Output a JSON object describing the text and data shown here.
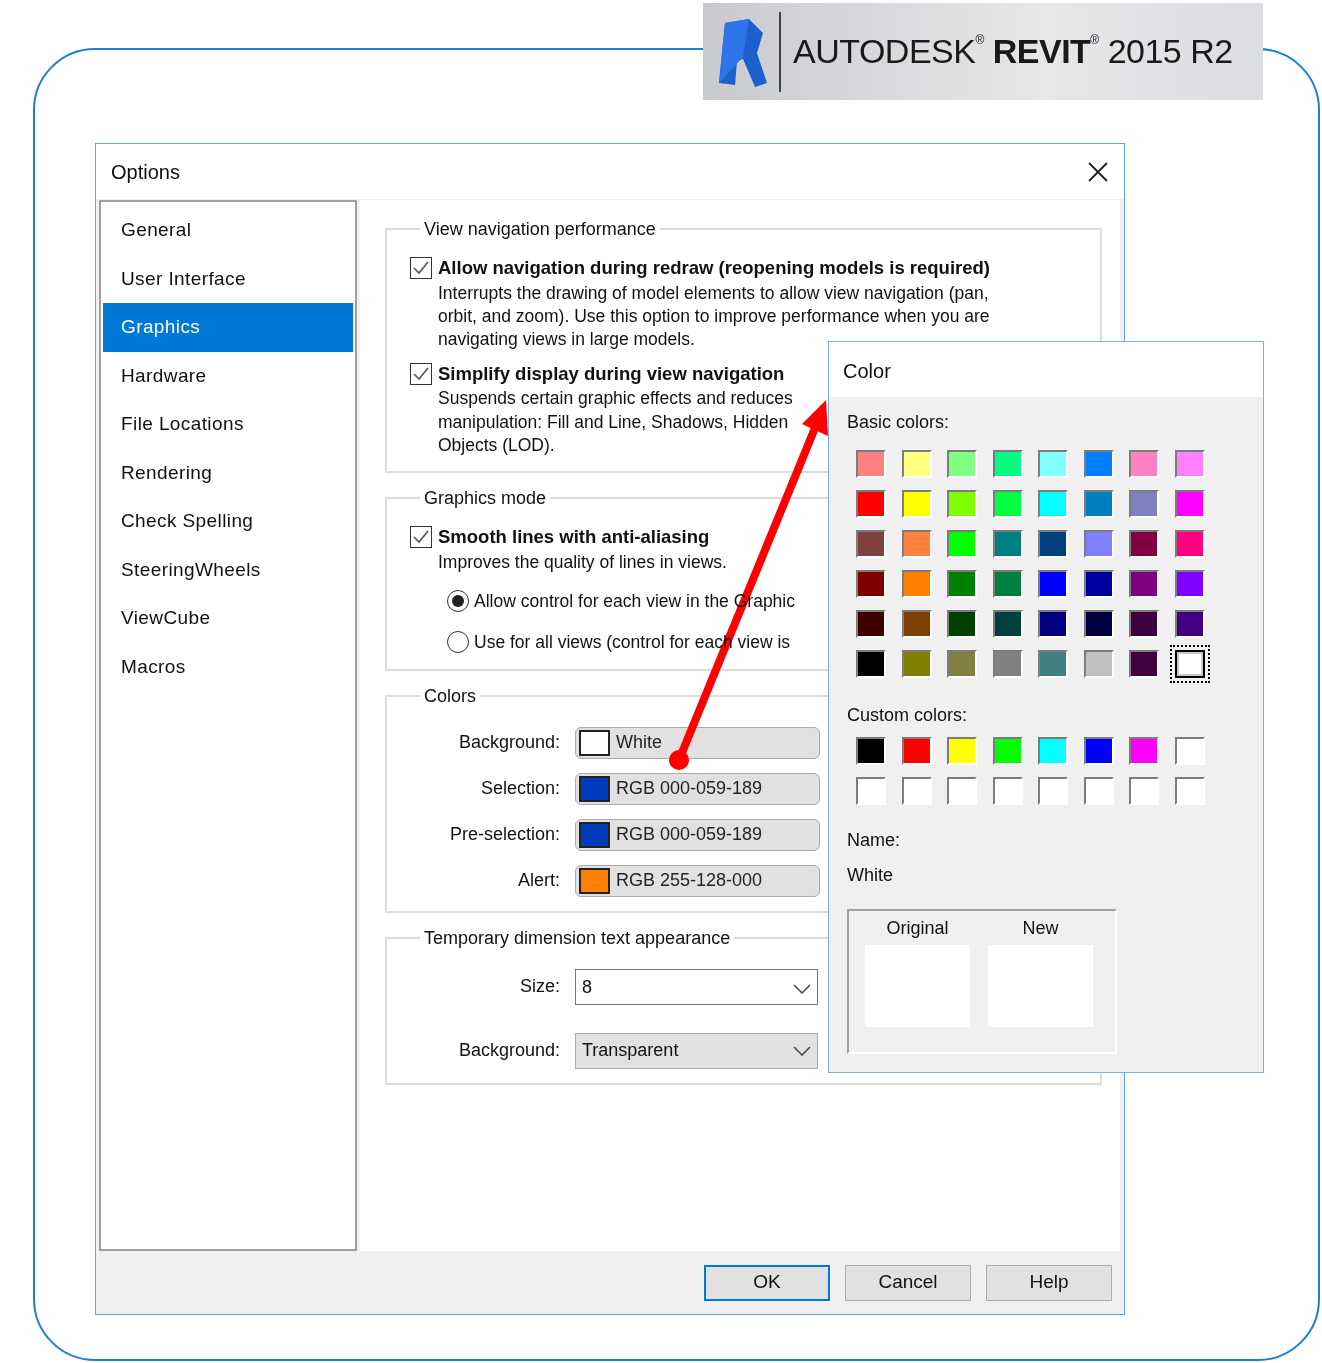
{
  "logo": {
    "text": "AUTODESK$^{®}$ **REVIT**$^{®}$ 2015 R2"
  },
  "options_dialog": {
    "title": "Options",
    "sidebar": {
      "items": [
        {
          "label": "General",
          "selected": false
        },
        {
          "label": "User Interface",
          "selected": false
        },
        {
          "label": "Graphics",
          "selected": true
        },
        {
          "label": "Hardware",
          "selected": false
        },
        {
          "label": "File Locations",
          "selected": false
        },
        {
          "label": "Rendering",
          "selected": false
        },
        {
          "label": "Check Spelling",
          "selected": false
        },
        {
          "label": "SteeringWheels",
          "selected": false
        },
        {
          "label": "ViewCube",
          "selected": false
        },
        {
          "label": "Macros",
          "selected": false
        }
      ]
    },
    "groups": [
      {
        "title": "View navigation performance",
        "items": [
          {
            "kind": "checkbox",
            "label": "Allow navigation during redraw (reopening models is required)",
            "checked": true,
            "description": "Interrupts the drawing of model elements to allow view navigation (pan,\norbit, and zoom). Use this option to improve performance when you are\nnavigating views in large models."
          },
          {
            "kind": "checkbox",
            "label": "Simplify display during view navigation",
            "checked": true,
            "description": "Suspends certain graphic effects and reduces\nmanipulation: Fill and Line, Shadows, Hidden\nObjects (LOD)."
          }
        ]
      },
      {
        "title": "Graphics mode",
        "items": [
          {
            "kind": "checkbox",
            "label": "Smooth lines with anti-aliasing",
            "checked": true,
            "description": "Improves the quality of lines in views."
          },
          {
            "kind": "radio",
            "label": "Allow control for each view in the Graphic",
            "selected": true
          },
          {
            "kind": "radio",
            "label": "Use for all views (control for each view is",
            "selected": false
          }
        ]
      },
      {
        "title": "Colors",
        "items": [
          {
            "kind": "color",
            "label": "Background:",
            "value": "White",
            "color": "#ffffff"
          },
          {
            "kind": "color",
            "label": "Selection:",
            "value": "RGB 000-059-189",
            "color": "#003bbd"
          },
          {
            "kind": "color",
            "label": "Pre-selection:",
            "value": "RGB 000-059-189",
            "color": "#003bbd"
          },
          {
            "kind": "color",
            "label": "Alert:",
            "value": "RGB 255-128-000",
            "color": "#ff8000"
          }
        ]
      },
      {
        "title": "Temporary dimension text appearance",
        "items": [
          {
            "kind": "combo",
            "label": "Size:",
            "value": "8",
            "editable": true
          },
          {
            "kind": "combo",
            "label": "Background:",
            "value": "Transparent",
            "editable": false
          }
        ]
      }
    ],
    "buttons": [
      {
        "label": "OK",
        "default": true
      },
      {
        "label": "Cancel",
        "default": false
      },
      {
        "label": "Help",
        "default": false
      }
    ]
  },
  "color_dialog": {
    "title": "Color",
    "basic_colors_label": "Basic colors:",
    "basic_colors": [
      {
        "color": "#ff8080",
        "selected": false
      },
      {
        "color": "#ffff80",
        "selected": false
      },
      {
        "color": "#80ff80",
        "selected": false
      },
      {
        "color": "#00ff80",
        "selected": false
      },
      {
        "color": "#80ffff",
        "selected": false
      },
      {
        "color": "#0080ff",
        "selected": false
      },
      {
        "color": "#ff80c0",
        "selected": false
      },
      {
        "color": "#ff80ff",
        "selected": false
      },
      {
        "color": "#ff0000",
        "selected": false
      },
      {
        "color": "#ffff00",
        "selected": false
      },
      {
        "color": "#80ff00",
        "selected": false
      },
      {
        "color": "#00ff40",
        "selected": false
      },
      {
        "color": "#00ffff",
        "selected": false
      },
      {
        "color": "#0080c0",
        "selected": false
      },
      {
        "color": "#8080c0",
        "selected": false
      },
      {
        "color": "#ff00ff",
        "selected": false
      },
      {
        "color": "#804040",
        "selected": false
      },
      {
        "color": "#ff8040",
        "selected": false
      },
      {
        "color": "#00ff00",
        "selected": false
      },
      {
        "color": "#008080",
        "selected": false
      },
      {
        "color": "#004080",
        "selected": false
      },
      {
        "color": "#8080ff",
        "selected": false
      },
      {
        "color": "#800040",
        "selected": false
      },
      {
        "color": "#ff0080",
        "selected": false
      },
      {
        "color": "#800000",
        "selected": false
      },
      {
        "color": "#ff8000",
        "selected": false
      },
      {
        "color": "#008000",
        "selected": false
      },
      {
        "color": "#008040",
        "selected": false
      },
      {
        "color": "#0000ff",
        "selected": false
      },
      {
        "color": "#0000a0",
        "selected": false
      },
      {
        "color": "#800080",
        "selected": false
      },
      {
        "color": "#8000ff",
        "selected": false
      },
      {
        "color": "#400000",
        "selected": false
      },
      {
        "color": "#804000",
        "selected": false
      },
      {
        "color": "#004000",
        "selected": false
      },
      {
        "color": "#004040",
        "selected": false
      },
      {
        "color": "#000080",
        "selected": false
      },
      {
        "color": "#000040",
        "selected": false
      },
      {
        "color": "#400040",
        "selected": false
      },
      {
        "color": "#400080",
        "selected": false
      },
      {
        "color": "#000000",
        "selected": false
      },
      {
        "color": "#808000",
        "selected": false
      },
      {
        "color": "#808040",
        "selected": false
      },
      {
        "color": "#808080",
        "selected": false
      },
      {
        "color": "#408080",
        "selected": false
      },
      {
        "color": "#c0c0c0",
        "selected": false
      },
      {
        "color": "#400040",
        "selected": false
      },
      {
        "color": "#ffffff",
        "selected": true
      }
    ],
    "custom_colors_label": "Custom colors:",
    "custom_colors": [
      {
        "color": "#000000"
      },
      {
        "color": "#ff0000"
      },
      {
        "color": "#ffff00"
      },
      {
        "color": "#00ff00"
      },
      {
        "color": "#00ffff"
      },
      {
        "color": "#0000ff"
      },
      {
        "color": "#ff00ff"
      },
      {
        "color": "#ffffff"
      },
      {
        "color": "#ffffff"
      },
      {
        "color": "#ffffff"
      },
      {
        "color": "#ffffff"
      },
      {
        "color": "#ffffff"
      },
      {
        "color": "#ffffff"
      },
      {
        "color": "#ffffff"
      },
      {
        "color": "#ffffff"
      },
      {
        "color": "#ffffff"
      }
    ],
    "name_label": "Name:",
    "name_value": "White",
    "preview": {
      "original_label": "Original",
      "new_label": "New"
    }
  }
}
